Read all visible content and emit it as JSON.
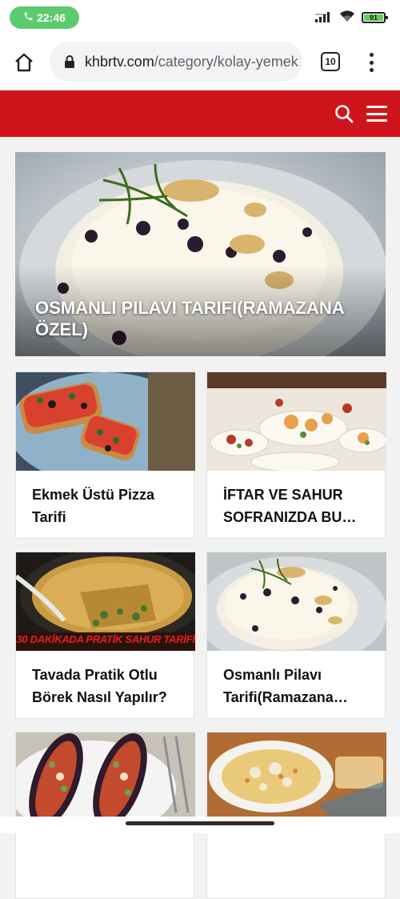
{
  "status_bar": {
    "call_time": "22:46",
    "battery": "91",
    "battery_level": 0.91
  },
  "browser": {
    "url_domain": "khbrtv.com",
    "url_path": "/category/kolay-yemek",
    "tab_count": "10"
  },
  "featured": {
    "title": "OSMANLI PILAVI TARIFI(RAMAZANA ÖZEL)"
  },
  "articles": [
    {
      "title": "Ekmek Üstü Pizza Tarifi"
    },
    {
      "title": "İFTAR VE SAHUR SOFRANIZDA BU…"
    },
    {
      "title": "Tavada Pratik Otlu Börek Nasıl Yapılır?",
      "image_caption": "30 DAKİKADA PRATİK SAHUR TARİFİ"
    },
    {
      "title": "Osmanlı Pilavı Tarifi(Ramazana…"
    },
    {
      "title": ""
    },
    {
      "title": ""
    }
  ],
  "colors": {
    "header_red": "#d0141c",
    "call_green": "#5ccb6f"
  }
}
